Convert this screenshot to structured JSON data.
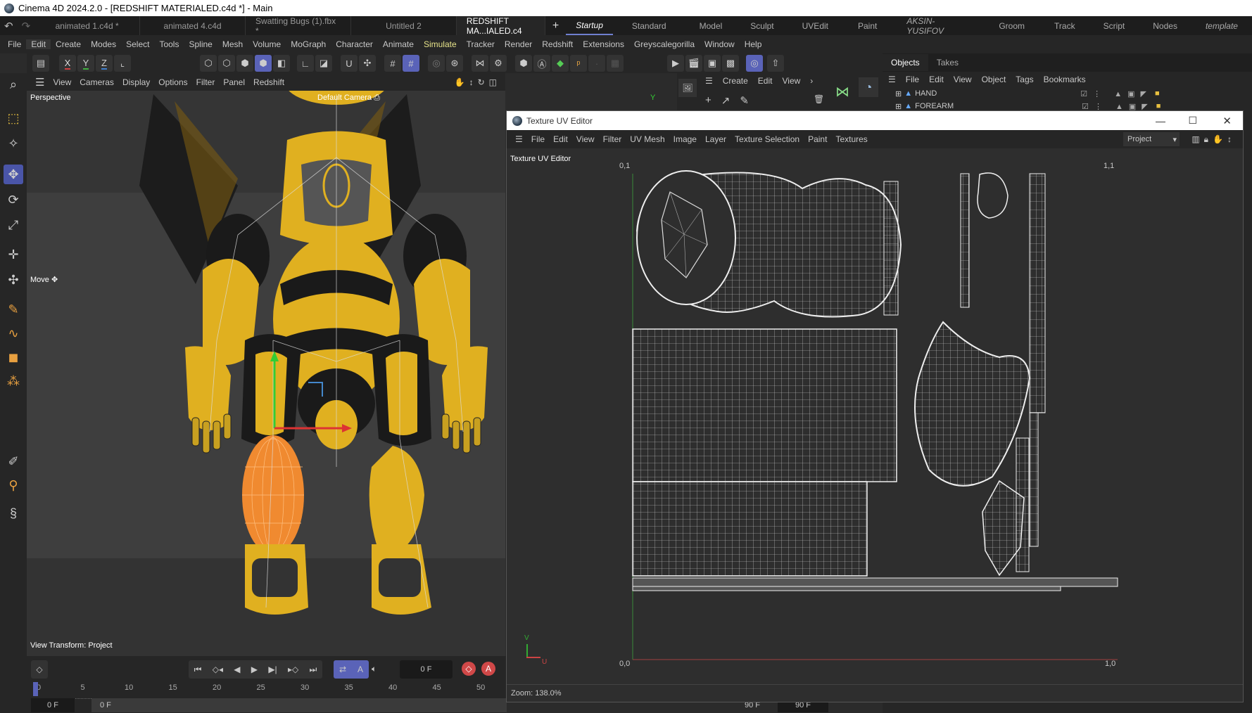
{
  "window_title": "Cinema 4D 2024.2.0 - [REDSHIFT MATERIALED.c4d *] - Main",
  "file_tabs": [
    "animated 1.c4d *",
    "animated 4.c4d",
    "Swatting Bugs (1).fbx *",
    "Untitled 2",
    "REDSHIFT MA...IALED.c4"
  ],
  "layout_tabs": [
    {
      "label": "Startup",
      "active": true
    },
    {
      "label": "Standard"
    },
    {
      "label": "Model"
    },
    {
      "label": "Sculpt"
    },
    {
      "label": "UVEdit"
    },
    {
      "label": "Paint"
    },
    {
      "label": "AKSIN-YUSIFOV",
      "italic": true
    },
    {
      "label": "Groom"
    },
    {
      "label": "Track"
    },
    {
      "label": "Script"
    },
    {
      "label": "Nodes"
    },
    {
      "label": "template",
      "italic": true
    }
  ],
  "main_menu": [
    "File",
    "Edit",
    "Create",
    "Modes",
    "Select",
    "Tools",
    "Spline",
    "Mesh",
    "Volume",
    "MoGraph",
    "Character",
    "Animate",
    "Simulate",
    "Tracker",
    "Render",
    "Redshift",
    "Extensions",
    "Greyscalegorilla",
    "Window",
    "Help"
  ],
  "axis_buttons": [
    "X",
    "Y",
    "Z"
  ],
  "viewport": {
    "menu": [
      "View",
      "Cameras",
      "Display",
      "Options",
      "Filter",
      "Panel",
      "Redshift"
    ],
    "label": "Perspective",
    "camera": "Default Camera",
    "tool_hint": "Move",
    "view_transform": "View Transform: Project",
    "axis_y": "Y"
  },
  "mid_panel": {
    "menu": [
      "Create",
      "Edit",
      "View"
    ]
  },
  "objects_panel": {
    "tabs": [
      "Objects",
      "Takes"
    ],
    "menu": [
      "File",
      "Edit",
      "View",
      "Object",
      "Tags",
      "Bookmarks"
    ],
    "items": [
      "HAND",
      "FOREARM"
    ]
  },
  "uv_editor": {
    "title": "Texture UV Editor",
    "menu": [
      "File",
      "Edit",
      "View",
      "Filter",
      "UV Mesh",
      "Image",
      "Layer",
      "Texture Selection",
      "Paint",
      "Textures"
    ],
    "view_label": "Texture UV Editor",
    "dropdown": "Project",
    "corners": {
      "tl": "0,1",
      "tr": "1,1",
      "bl": "0,0",
      "br": "1,0"
    },
    "axis_v": "V",
    "axis_u": "U",
    "zoom": "Zoom: 138.0%"
  },
  "timeline": {
    "current_frame": "0 F",
    "ruler": [
      "0",
      "5",
      "10",
      "15",
      "20",
      "25",
      "30",
      "35",
      "40",
      "45",
      "50"
    ],
    "start": "0 F",
    "range_start": "0 F",
    "range_end": "90 F",
    "end": "90 F"
  },
  "colors": {
    "accent": "#5a63b8",
    "highlight_menu": "#e7e38a",
    "bee_yellow": "#e0b020",
    "uv_selected": "#f08a30"
  }
}
